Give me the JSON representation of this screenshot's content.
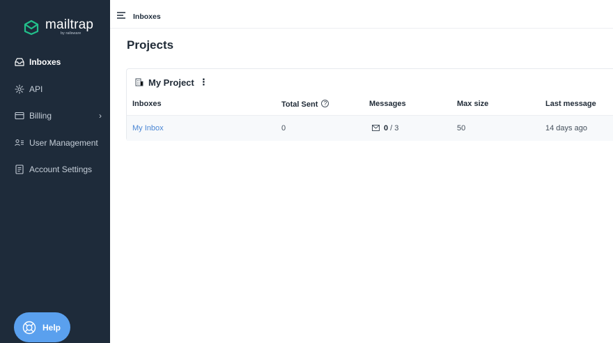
{
  "brand": {
    "name": "mailtrap",
    "tagline": "by railsware",
    "accent": "#22c08b",
    "sidebar_bg": "#1e2b3a"
  },
  "sidebar": {
    "items": [
      {
        "label": "Inboxes",
        "icon": "inbox-icon",
        "active": true
      },
      {
        "label": "API",
        "icon": "gear-icon"
      },
      {
        "label": "Billing",
        "icon": "credit-card-icon",
        "chevron": "›"
      },
      {
        "label": "User Management",
        "icon": "users-icon"
      },
      {
        "label": "Account Settings",
        "icon": "document-icon"
      }
    ],
    "help_label": "Help"
  },
  "topbar": {
    "breadcrumb": "Inboxes"
  },
  "page": {
    "title": "Projects"
  },
  "project": {
    "name": "My Project",
    "menu": "⋮",
    "columns": [
      "Inboxes",
      "Total Sent",
      "Messages",
      "Max size",
      "Last message"
    ],
    "total_sent_help": "?",
    "rows": [
      {
        "inbox": "My Inbox",
        "total_sent": "0",
        "messages_count": "0",
        "messages_total": " / 3",
        "max_size": "50",
        "last_message": "14 days ago"
      }
    ]
  }
}
